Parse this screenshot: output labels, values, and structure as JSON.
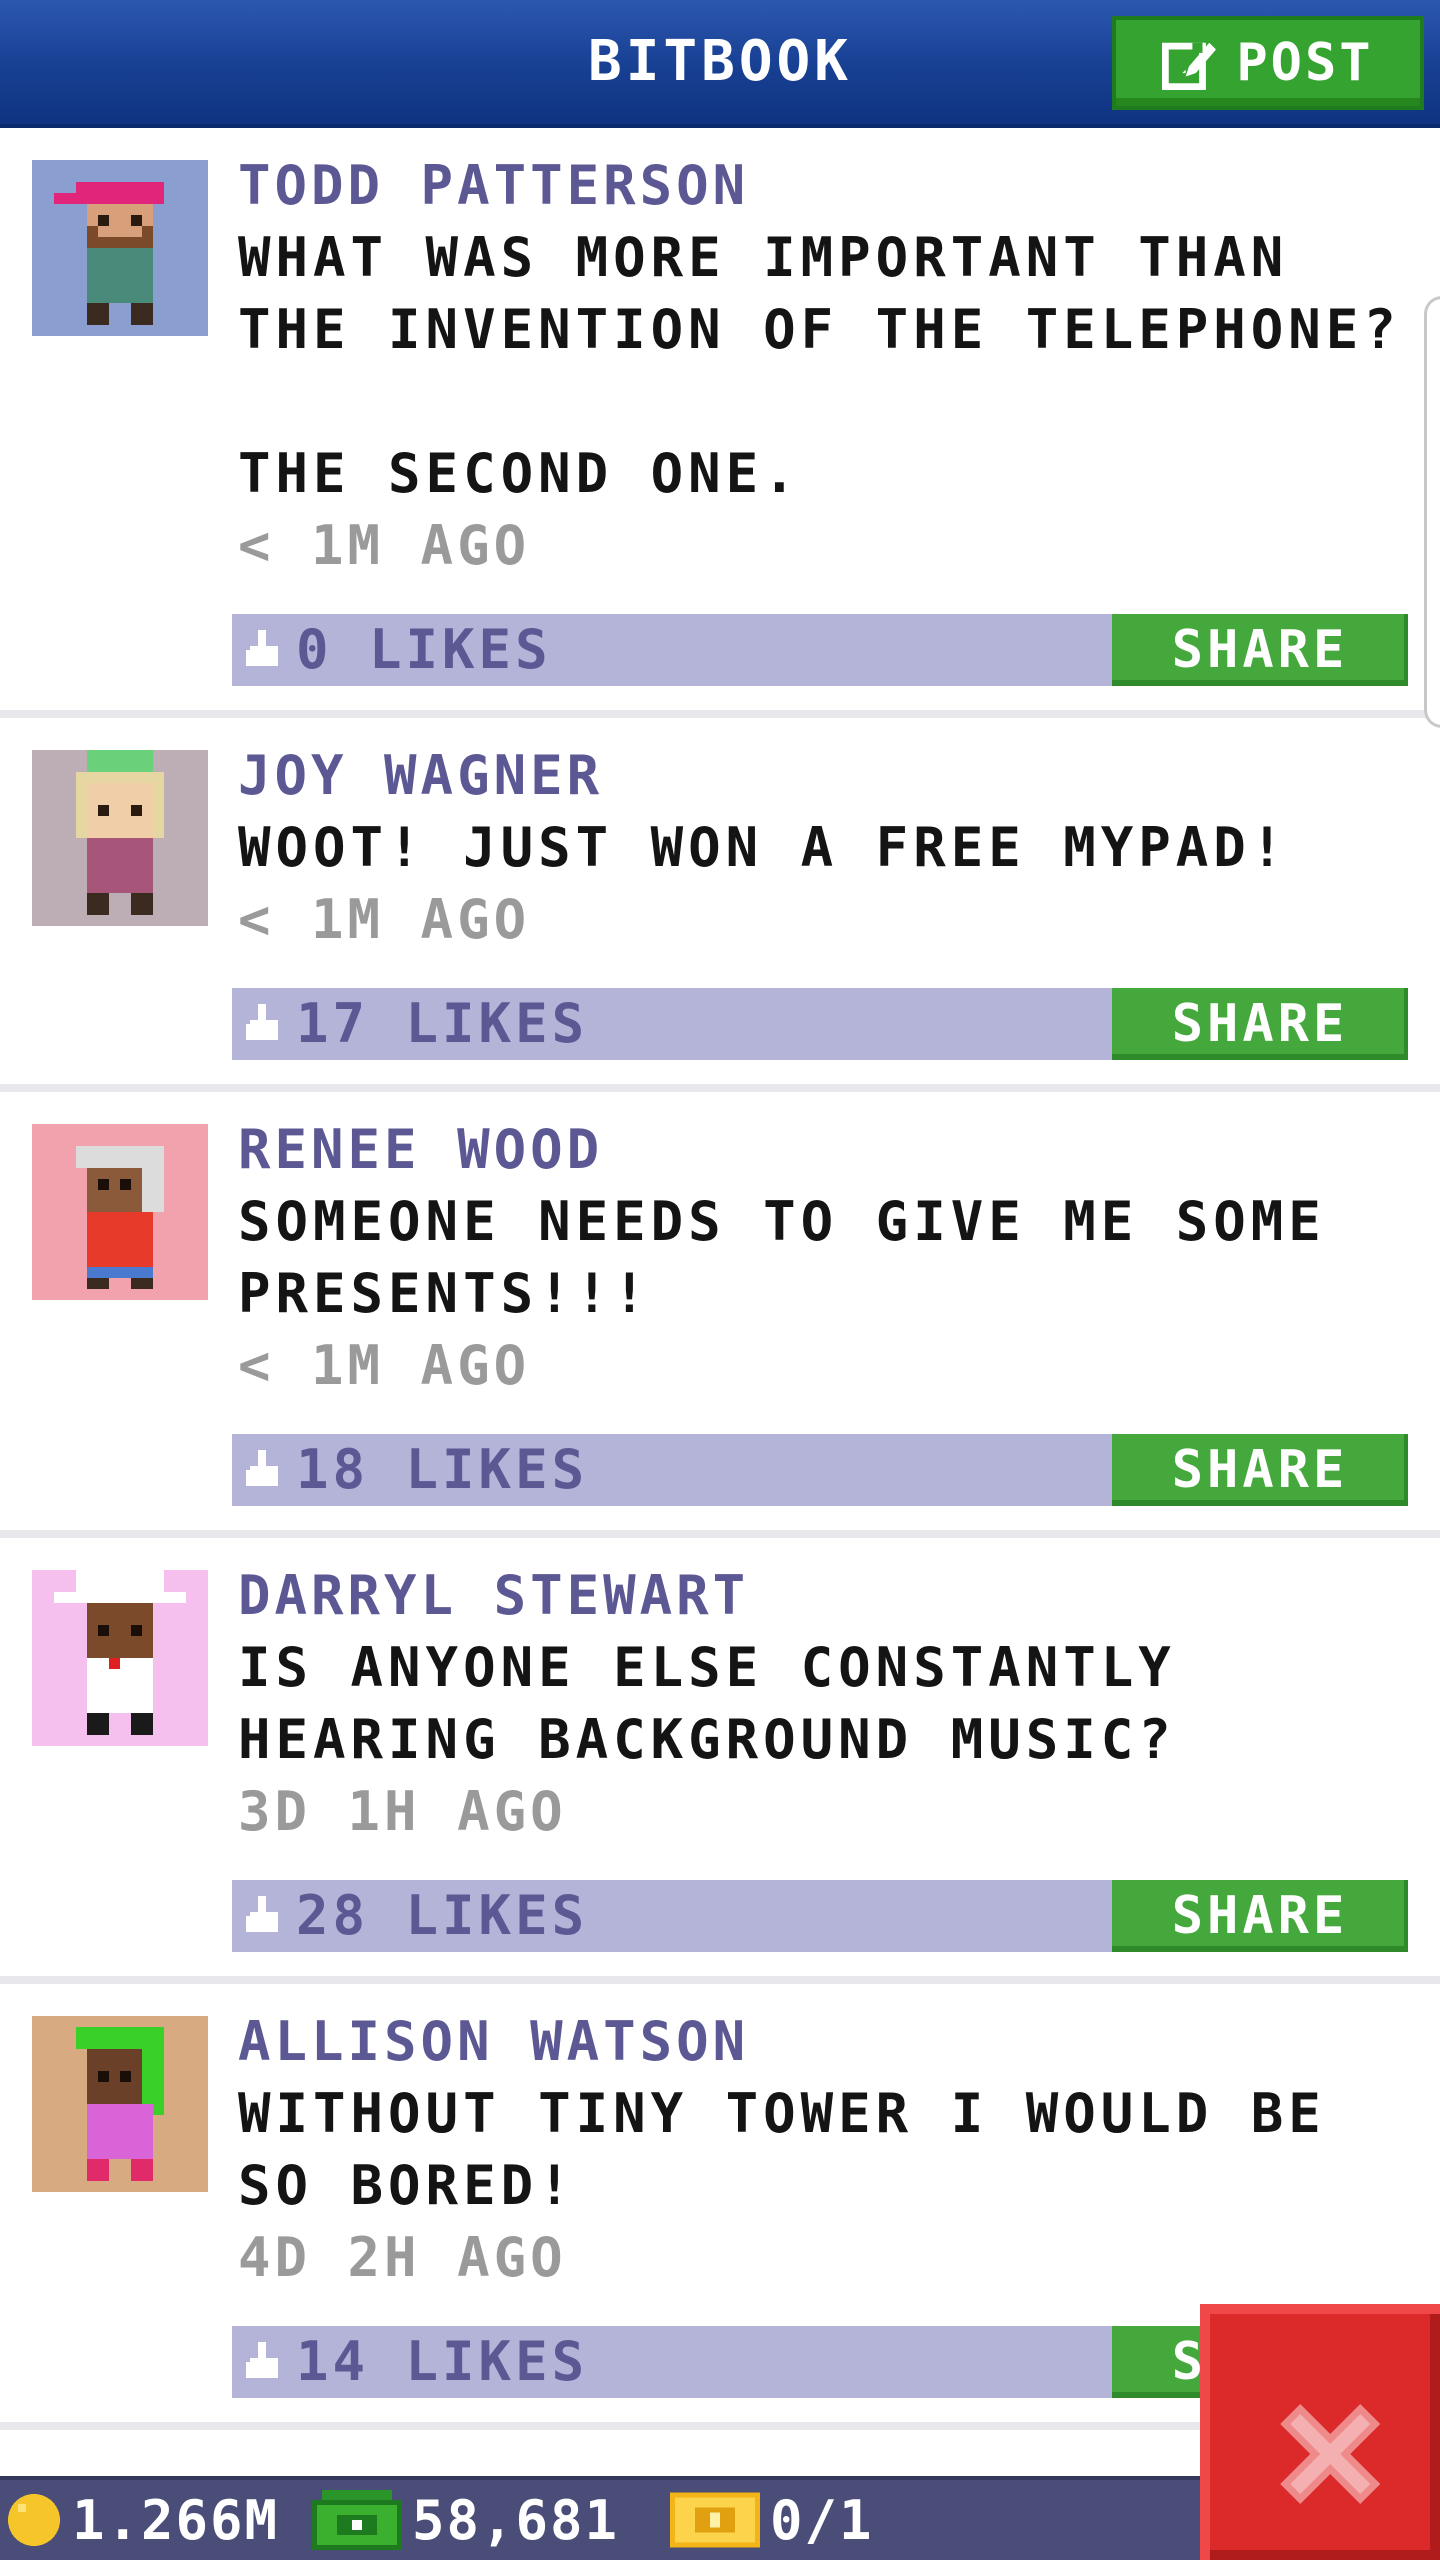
{
  "header": {
    "title": "BITBOOK",
    "post_button_label": "POST",
    "post_button_icon": "compose-icon"
  },
  "feed": {
    "posts": [
      {
        "author": "TODD PATTERSON",
        "message": "WHAT WAS MORE IMPORTANT THAN THE INVENTION OF THE TELEPHONE?\n\nTHE SECOND ONE.",
        "time": "< 1M AGO",
        "likes": "0 LIKES",
        "share_label": "SHARE",
        "avatar_bg": "#8a9fd0"
      },
      {
        "author": "JOY WAGNER",
        "message": "WOOT! JUST WON A FREE MYPAD!",
        "time": "< 1M AGO",
        "likes": "17 LIKES",
        "share_label": "SHARE",
        "avatar_bg": "#bcaeb4"
      },
      {
        "author": "RENEE WOOD",
        "message": "SOMEONE NEEDS TO GIVE ME SOME PRESENTS!!!",
        "time": "< 1M AGO",
        "likes": "18 LIKES",
        "share_label": "SHARE",
        "avatar_bg": "#f2a2ac"
      },
      {
        "author": "DARRYL STEWART",
        "message": "IS ANYONE ELSE CONSTANTLY HEARING BACKGROUND MUSIC?",
        "time": "3D 1H AGO",
        "likes": "28 LIKES",
        "share_label": "SHARE",
        "avatar_bg": "#f6c0ee"
      },
      {
        "author": "ALLISON WATSON",
        "message": "WITHOUT TINY TOWER I WOULD BE SO BORED!",
        "time": "4D 2H AGO",
        "likes": "14 LIKES",
        "share_label": "SHARE",
        "avatar_bg": "#d8aa82"
      }
    ]
  },
  "bottom_bar": {
    "coins": "1.266M",
    "bux": "58,681",
    "tickets": "0/1",
    "coin_icon": "coin-icon",
    "bux_icon": "cash-icon",
    "ticket_icon": "ticket-icon"
  },
  "close_button_icon": "close-icon",
  "colors": {
    "header_blue": "#173f92",
    "accent_green": "#45a83c",
    "like_bar": "#b3b4d8",
    "author_purple": "#5c5894",
    "close_red": "#dc2a2a"
  }
}
